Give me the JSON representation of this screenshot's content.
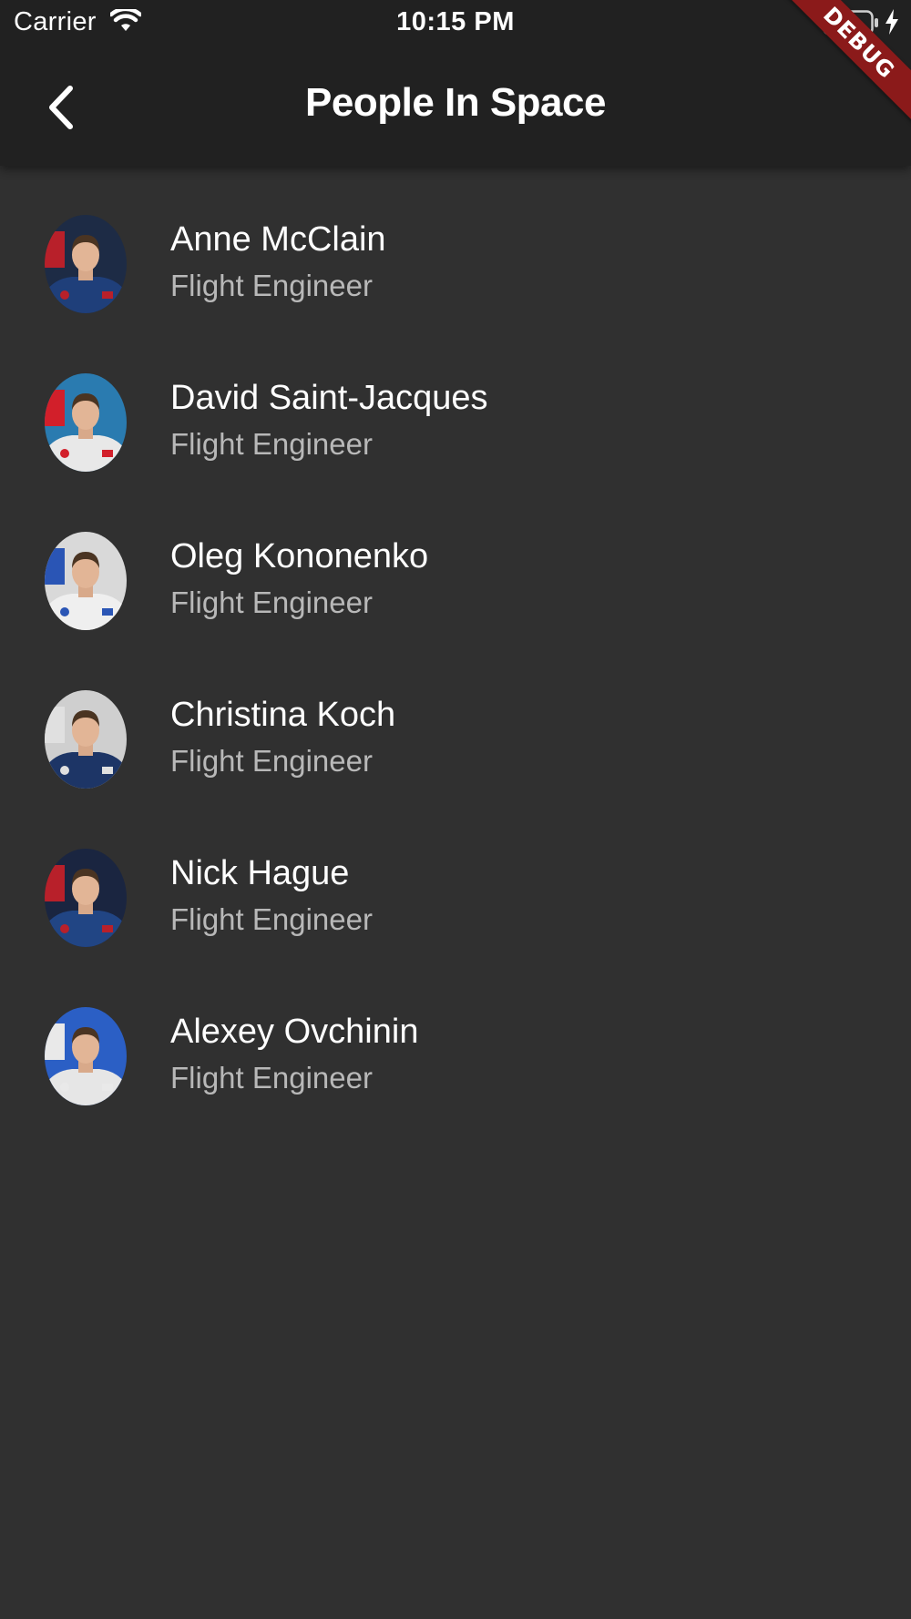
{
  "status_bar": {
    "carrier": "Carrier",
    "time": "10:15 PM",
    "battery_color": "#4cd964"
  },
  "app_bar": {
    "title": "People In Space",
    "back_icon": "chevron-left-icon"
  },
  "debug_banner": "DEBUG",
  "people": [
    {
      "name": "Anne McClain",
      "role": "Flight Engineer",
      "bg": "#1d2b45",
      "suit": "#1f3f7a",
      "accent": "#b8202a"
    },
    {
      "name": "David Saint-Jacques",
      "role": "Flight Engineer",
      "bg": "#2a7bb0",
      "suit": "#e8e8e8",
      "accent": "#d21f2a"
    },
    {
      "name": "Oleg Kononenko",
      "role": "Flight Engineer",
      "bg": "#d9d9d9",
      "suit": "#efefef",
      "accent": "#2a55b5"
    },
    {
      "name": "Christina Koch",
      "role": "Flight Engineer",
      "bg": "#cfcfcf",
      "suit": "#1d3566",
      "accent": "#e0e0e0"
    },
    {
      "name": "Nick Hague",
      "role": "Flight Engineer",
      "bg": "#1a2540",
      "suit": "#214584",
      "accent": "#b8202a"
    },
    {
      "name": "Alexey Ovchinin",
      "role": "Flight Engineer",
      "bg": "#2b5fc5",
      "suit": "#e6e6e6",
      "accent": "#e9e9e9"
    }
  ]
}
